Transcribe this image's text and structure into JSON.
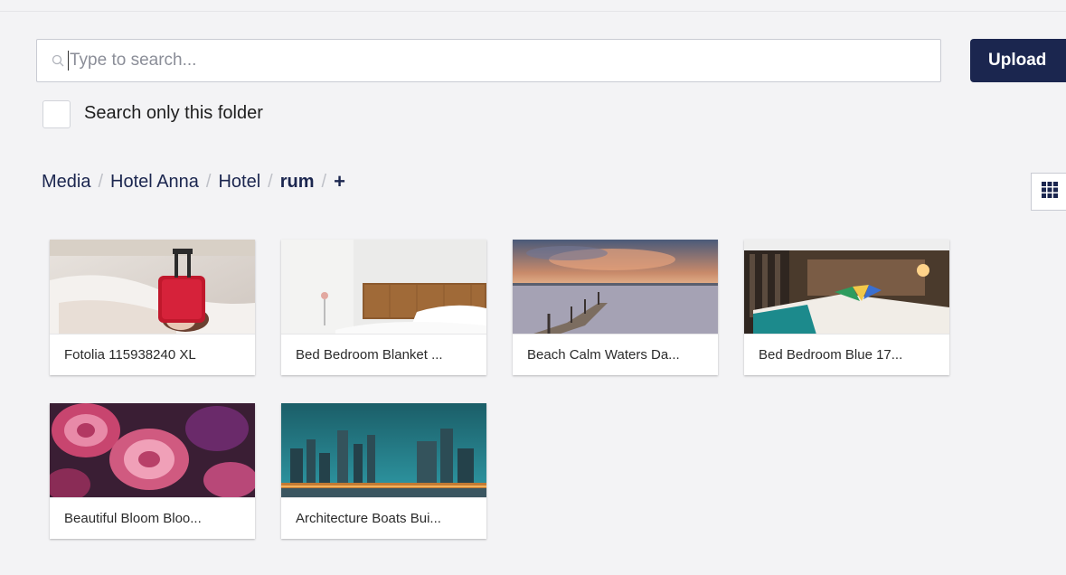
{
  "search": {
    "placeholder": "Type to search...",
    "value": ""
  },
  "toolbar": {
    "upload_label": "Upload"
  },
  "filter": {
    "search_only_folder_label": "Search only this folder",
    "search_only_folder_checked": false
  },
  "breadcrumb": {
    "items": [
      "Media",
      "Hotel Anna",
      "Hotel",
      "rum"
    ],
    "separator": "/",
    "add_label": "+"
  },
  "view": {
    "grid_icon": "grid-icon"
  },
  "media": {
    "items": [
      {
        "caption": "Fotolia 115938240 XL",
        "icon": "photo-woman-suitcase"
      },
      {
        "caption": "Bed Bedroom Blanket ...",
        "icon": "photo-bed-headboard"
      },
      {
        "caption": "Beach Calm Waters Da...",
        "icon": "photo-pier-sunset"
      },
      {
        "caption": "Bed Bedroom Blue 17...",
        "icon": "photo-hotel-room"
      },
      {
        "caption": "Beautiful Bloom Bloo...",
        "icon": "photo-pink-roses"
      },
      {
        "caption": "Architecture Boats Bui...",
        "icon": "photo-city-skyline"
      }
    ]
  },
  "colors": {
    "brand_navy": "#1b264f",
    "background": "#f3f3f5"
  }
}
